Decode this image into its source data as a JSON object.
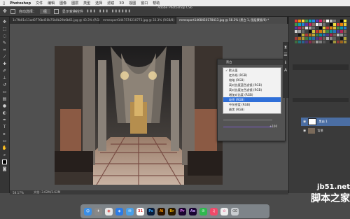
{
  "menubar": {
    "apple": "",
    "app_name": "Photoshop",
    "items": [
      "文件",
      "编辑",
      "图像",
      "图层",
      "类型",
      "选择",
      "滤镜",
      "3D",
      "视图",
      "窗口",
      "帮助"
    ]
  },
  "window_title": "Adobe Photoshop CS6",
  "options": {
    "auto_select": "自动选择：",
    "group": "组",
    "transform": "显示变换控件"
  },
  "tabs": [
    "1c7fb01c11ad0776bd50b75b0b29b6b61.jpg @ 43.3% (RGB/8)",
    "mmexport1447574210773.jpg @ 33.3% (RGB/8)",
    "mmexport1468450178413.jpg @ 58.3% (黑白 1, 图层蒙版/8) *"
  ],
  "status": {
    "zoom": "58.17%",
    "doc": "文档: 3.62M/3.62M"
  },
  "dialog": {
    "title": "属性",
    "header_label": "黑白",
    "menu_items": [
      "默认值",
      "红外线 (RGB)",
      "较暗 (RGB)",
      "高对比度蓝色滤镜 (RGB)",
      "高对比度红色滤镜 (RGB)",
      "增加对比度 (RGB)",
      "较亮 (RGB)",
      "中灰密度 (RGB)",
      "最黑 (RGB)",
      "最白 (RGB)",
      "自定"
    ],
    "selected_index": 7,
    "value_label": "0",
    "percent": "+100"
  },
  "layers": {
    "layer_name": "黑白 1",
    "background": "背景"
  },
  "watermark": {
    "line1": "jb51.net",
    "line2": "脚本之家"
  },
  "dock_apps": [
    "Finder",
    "Launchpad",
    "Chrome",
    "Safari",
    "Mail",
    "Calendar",
    "Ps",
    "Ai",
    "Br",
    "Pr",
    "Ae",
    "Wt",
    "Music",
    "Photos",
    "Trash"
  ]
}
